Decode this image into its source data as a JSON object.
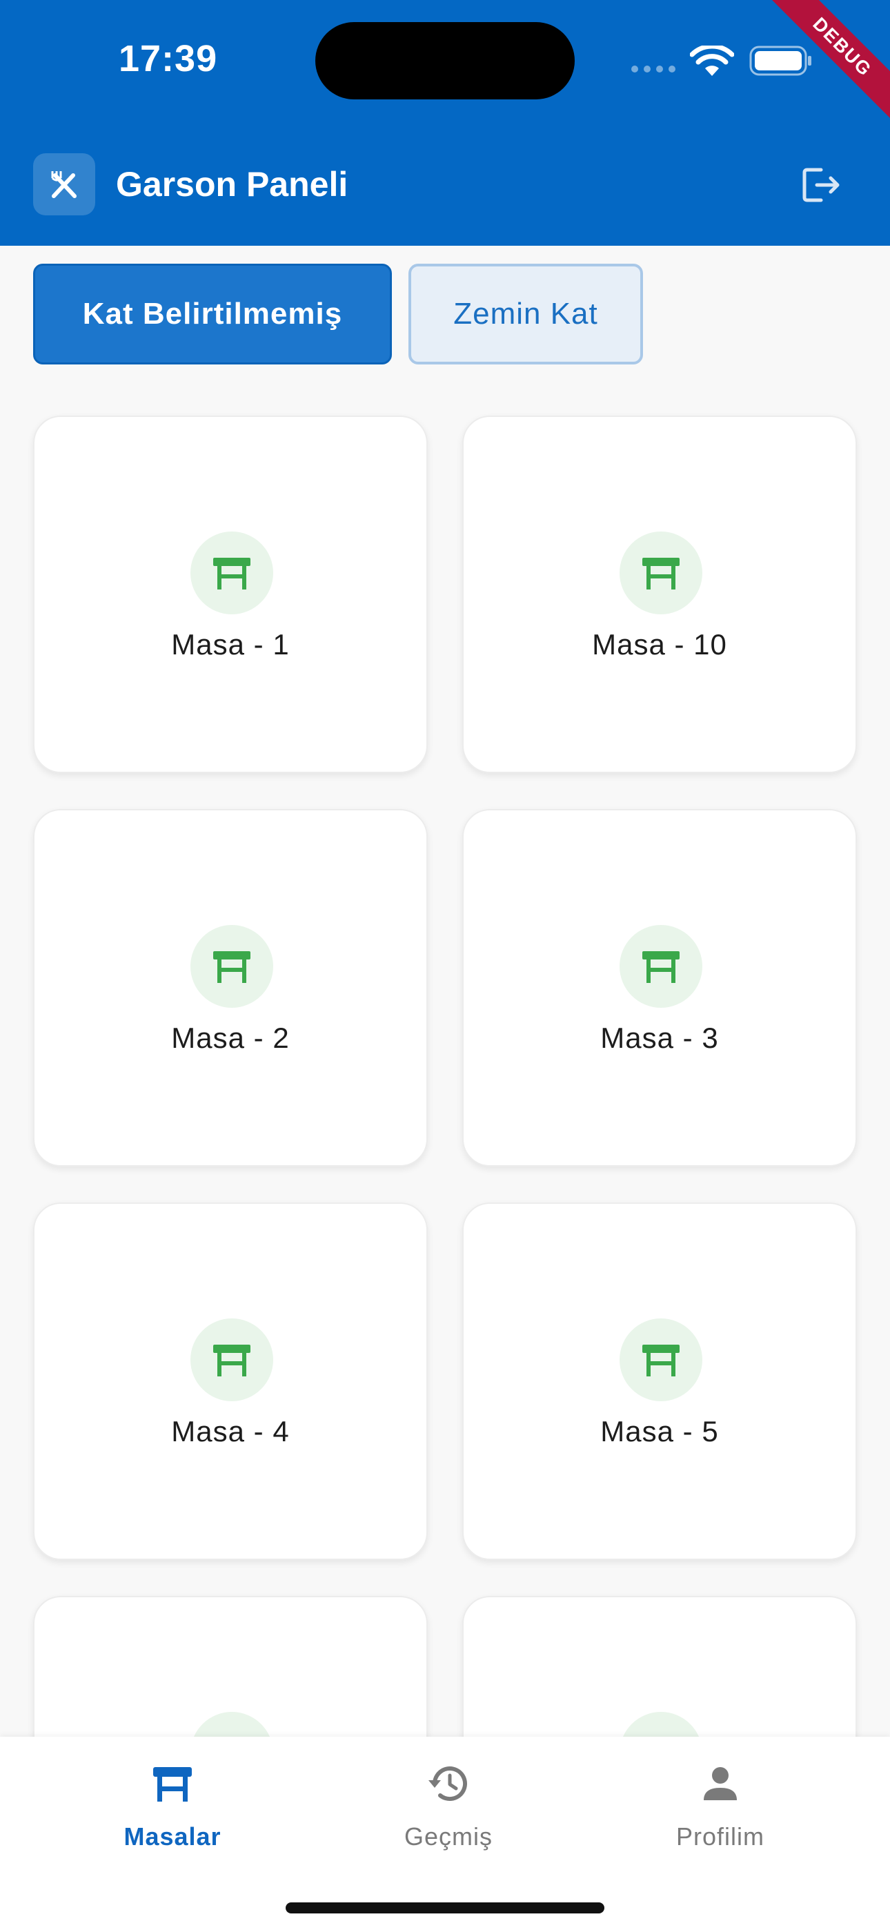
{
  "status_bar": {
    "time": "17:39"
  },
  "debug_banner": "DEBUG",
  "app_bar": {
    "title": "Garson Paneli"
  },
  "floors": [
    {
      "label": "Kat Belirtilmemiş",
      "selected": true
    },
    {
      "label": "Zemin Kat",
      "selected": false
    }
  ],
  "tables": [
    {
      "label": "Masa - 1"
    },
    {
      "label": "Masa - 10"
    },
    {
      "label": "Masa - 2"
    },
    {
      "label": "Masa - 3"
    },
    {
      "label": "Masa - 4"
    },
    {
      "label": "Masa - 5"
    },
    {
      "label": ""
    },
    {
      "label": ""
    }
  ],
  "bottom_nav": {
    "items": [
      {
        "label": "Masalar",
        "icon": "table-icon",
        "active": true
      },
      {
        "label": "Geçmiş",
        "icon": "history-icon",
        "active": false
      },
      {
        "label": "Profilim",
        "icon": "person-icon",
        "active": false
      }
    ]
  },
  "colors": {
    "primary": "#0468c4",
    "table_icon": "#3aa84a",
    "table_icon_bg": "#e9f5ea",
    "nav_active": "#0f66c0",
    "nav_inactive": "#7a7a7a"
  }
}
